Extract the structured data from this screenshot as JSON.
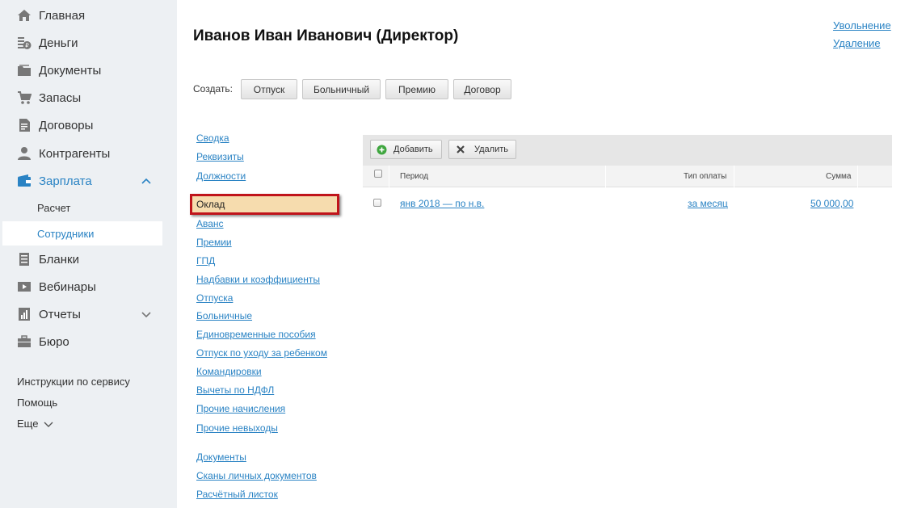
{
  "sidebar": {
    "items": [
      {
        "label": "Главная",
        "icon": "home-icon"
      },
      {
        "label": "Деньги",
        "icon": "money-icon"
      },
      {
        "label": "Документы",
        "icon": "folder-icon"
      },
      {
        "label": "Запасы",
        "icon": "cart-icon"
      },
      {
        "label": "Договоры",
        "icon": "contract-icon"
      },
      {
        "label": "Контрагенты",
        "icon": "person-icon"
      },
      {
        "label": "Зарплата",
        "icon": "wallet-icon"
      },
      {
        "label": "Бланки",
        "icon": "form-icon"
      },
      {
        "label": "Вебинары",
        "icon": "video-icon"
      },
      {
        "label": "Отчеты",
        "icon": "report-icon"
      },
      {
        "label": "Бюро",
        "icon": "briefcase-icon"
      }
    ],
    "sub_items": [
      {
        "label": "Расчет"
      },
      {
        "label": "Сотрудники"
      }
    ],
    "footer": {
      "instructions": "Инструкции по сервису",
      "help": "Помощь",
      "more": "Еще"
    }
  },
  "header": {
    "title": "Иванов Иван Иванович (Директор)",
    "links": {
      "dismiss": "Увольнение",
      "delete": "Удаление"
    }
  },
  "create_bar": {
    "label": "Создать:",
    "buttons": [
      "Отпуск",
      "Больничный",
      "Премию",
      "Договор"
    ]
  },
  "employee_menu": {
    "group1": [
      "Сводка",
      "Реквизиты",
      "Должности"
    ],
    "selected": "Оклад",
    "group2": [
      "Аванс",
      "Премии",
      "ГПД",
      "Надбавки и коэффициенты",
      "Отпуска",
      "Больничные",
      "Единовременные пособия",
      "Отпуск по уходу за ребенком",
      "Командировки",
      "Вычеты по НДФЛ",
      "Прочие начисления",
      "Прочие невыходы"
    ],
    "group3": [
      "Документы",
      "Сканы личных документов",
      "Расчётный листок"
    ]
  },
  "table": {
    "toolbar": {
      "add": "Добавить",
      "delete": "Удалить"
    },
    "columns": [
      "Период",
      "Тип оплаты",
      "Сумма"
    ],
    "rows": [
      {
        "period": "янв 2018 — по н.в.",
        "pay_type": "за месяц",
        "amount": "50 000,00"
      }
    ]
  },
  "colors": {
    "sidebar_bg": "#edf0f3",
    "accent": "#2a83c4",
    "highlight_bg": "#f6dcae",
    "highlight_border": "#c0141b"
  }
}
